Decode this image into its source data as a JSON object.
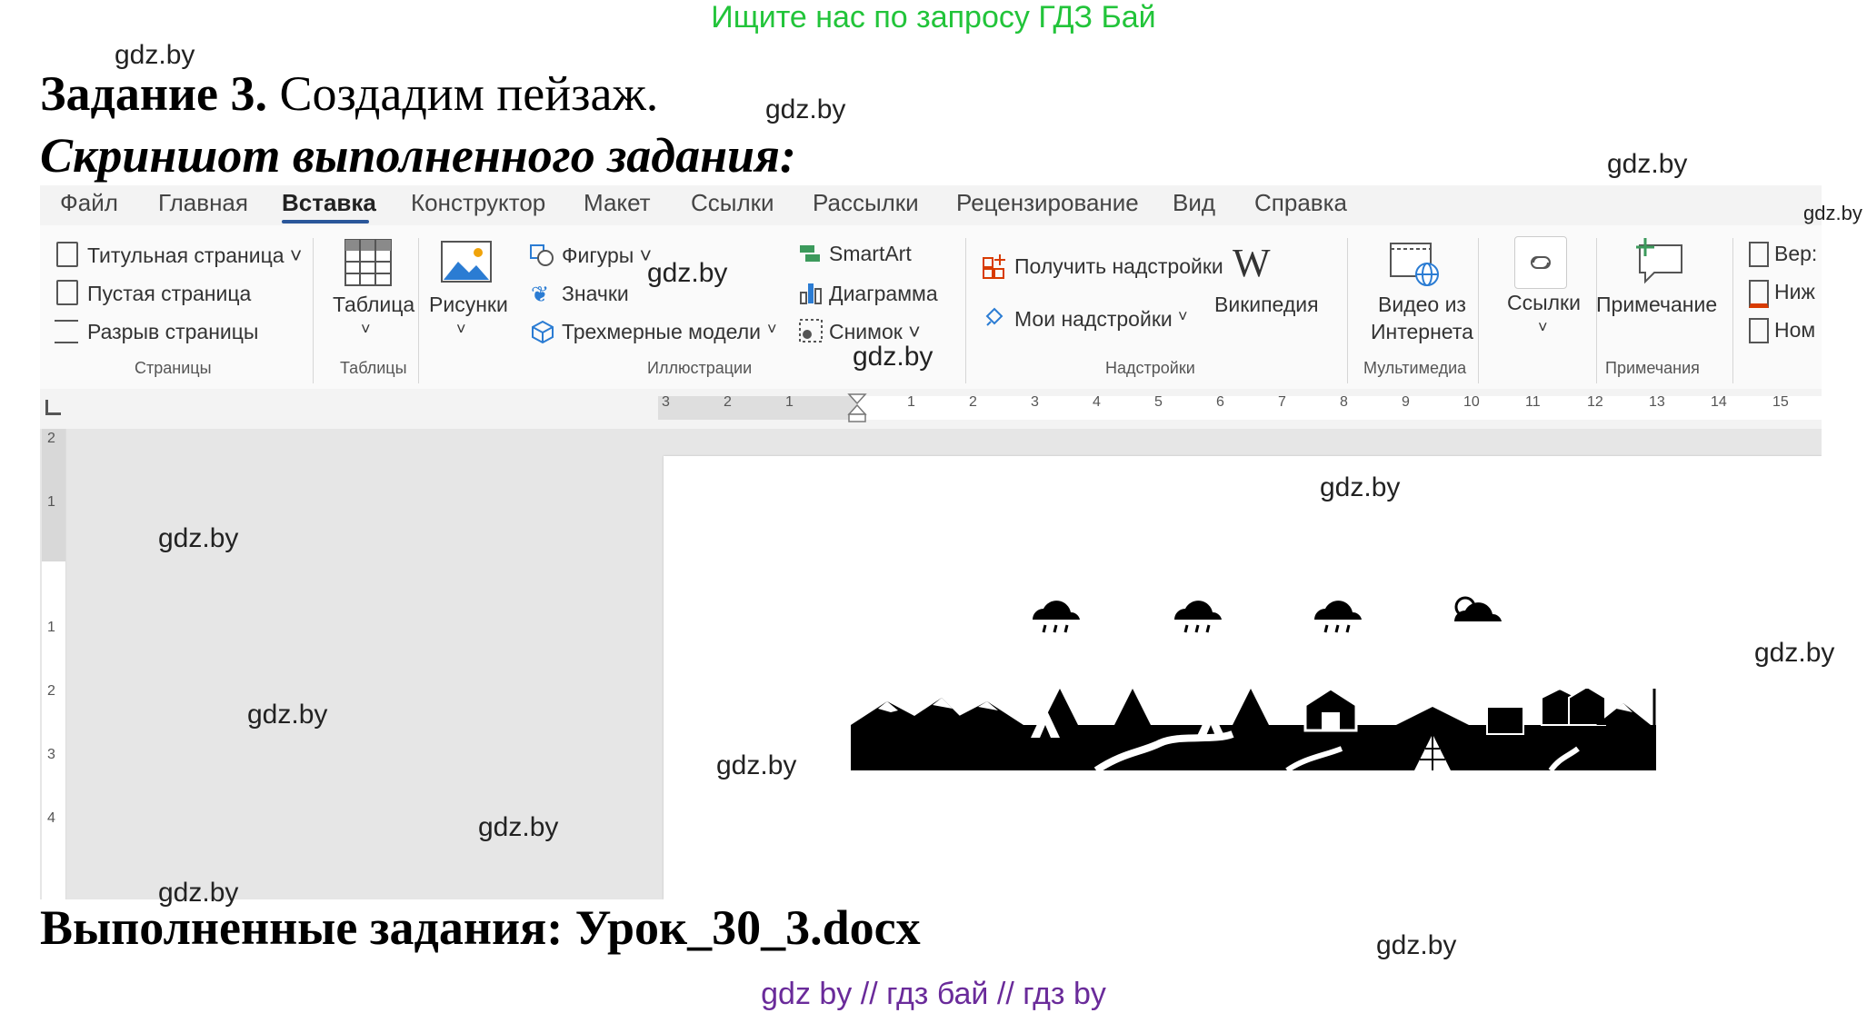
{
  "banner": "Ищите нас по запросу ГДЗ Бай",
  "task": {
    "bold": "Задание 3.",
    "text": " Создадим пейзаж."
  },
  "subtitle": "Скриншот выполненного задания:",
  "done": "Выполненные задания: Урок_30_3.docx",
  "footer": "gdz by  //  гдз бай  //  гдз by",
  "watermark": "gdz.by",
  "tabs": [
    "Файл",
    "Главная",
    "Вставка",
    "Конструктор",
    "Макет",
    "Ссылки",
    "Рассылки",
    "Рецензирование",
    "Вид",
    "Справка"
  ],
  "active_tab": "Вставка",
  "pages_group": {
    "items": [
      "Титульная страница",
      "Пустая страница",
      "Разрыв страницы"
    ],
    "label": "Страницы"
  },
  "tables_group": {
    "button": "Таблица",
    "label": "Таблицы"
  },
  "illustrations_group": {
    "pictures": "Рисунки",
    "shapes": "Фигуры",
    "icons": "Значки",
    "models3d": "Трехмерные модели",
    "smartart": "SmartArt",
    "chart": "Диаграмма",
    "screenshot": "Снимок",
    "label": "Иллюстрации"
  },
  "addins_group": {
    "get": "Получить надстройки",
    "mine": "Мои надстройки",
    "wiki": "Википедия",
    "label": "Надстройки"
  },
  "media_group": {
    "video_line1": "Видео из",
    "video_line2": "Интернета",
    "label": "Мультимедиа"
  },
  "links_group": {
    "button": "Ссылки"
  },
  "comments_group": {
    "button": "Примечание",
    "label": "Примечания"
  },
  "header_footer_group": {
    "items": [
      "Вер:",
      "Ниж",
      "Ном"
    ]
  },
  "ruler_labels": [
    "3",
    "2",
    "1",
    "1",
    "2",
    "3",
    "4",
    "5",
    "6",
    "7",
    "8",
    "9",
    "10",
    "11",
    "12",
    "13",
    "14",
    "15"
  ],
  "vruler_labels": [
    "2",
    "1",
    "1",
    "2",
    "3",
    "4"
  ],
  "colors": {
    "accent": "#2b579a",
    "banner": "#22c43a",
    "footer": "#6a2b9a"
  }
}
